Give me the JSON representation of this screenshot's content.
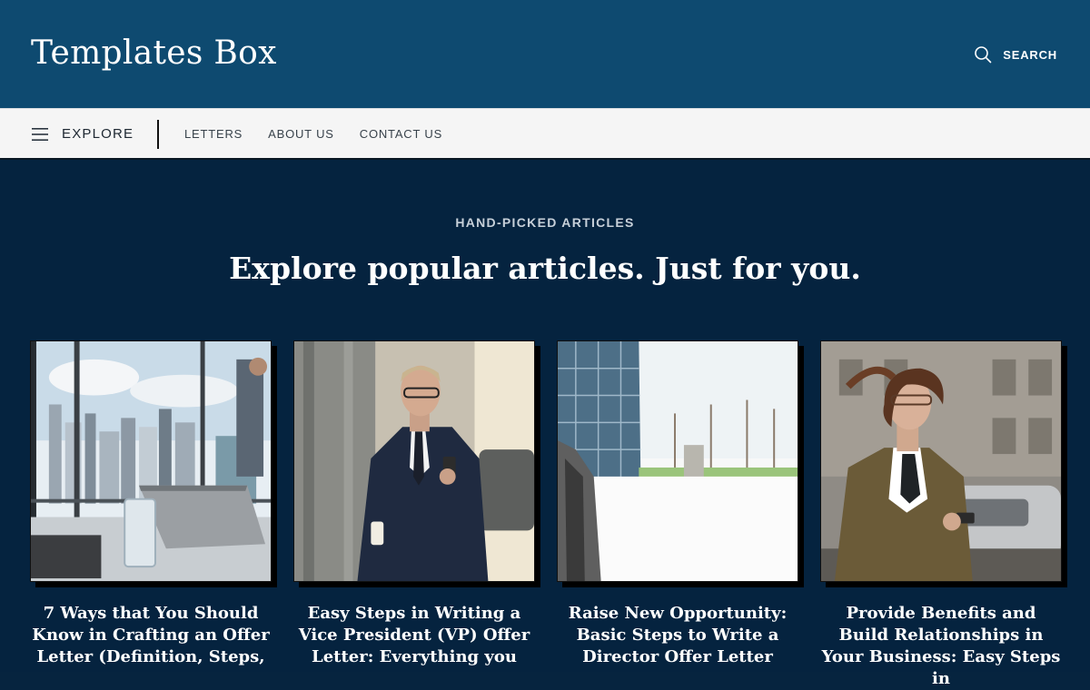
{
  "header": {
    "logo": "Templates Box",
    "search_label": "SEARCH"
  },
  "nav": {
    "explore_label": "EXPLORE",
    "links": [
      "LETTERS",
      "ABOUT US",
      "CONTACT US"
    ]
  },
  "hero": {
    "eyebrow": "HAND-PICKED ARTICLES",
    "headline": "Explore popular articles. Just for you."
  },
  "articles": [
    {
      "title": "7 Ways that You Should Know in Crafting an Offer Letter (Definition, Steps,"
    },
    {
      "title": "Easy Steps in Writing a Vice President (VP) Offer Letter: Everything you"
    },
    {
      "title": "Raise New Opportunity: Basic Steps to Write a Director Offer Letter"
    },
    {
      "title": "Provide Benefits and Build Relationships in Your Business: Easy Steps in"
    }
  ],
  "colors": {
    "header_bg": "#0e4a70",
    "nav_bg": "#f5f5f5",
    "hero_bg": "#05233f"
  }
}
